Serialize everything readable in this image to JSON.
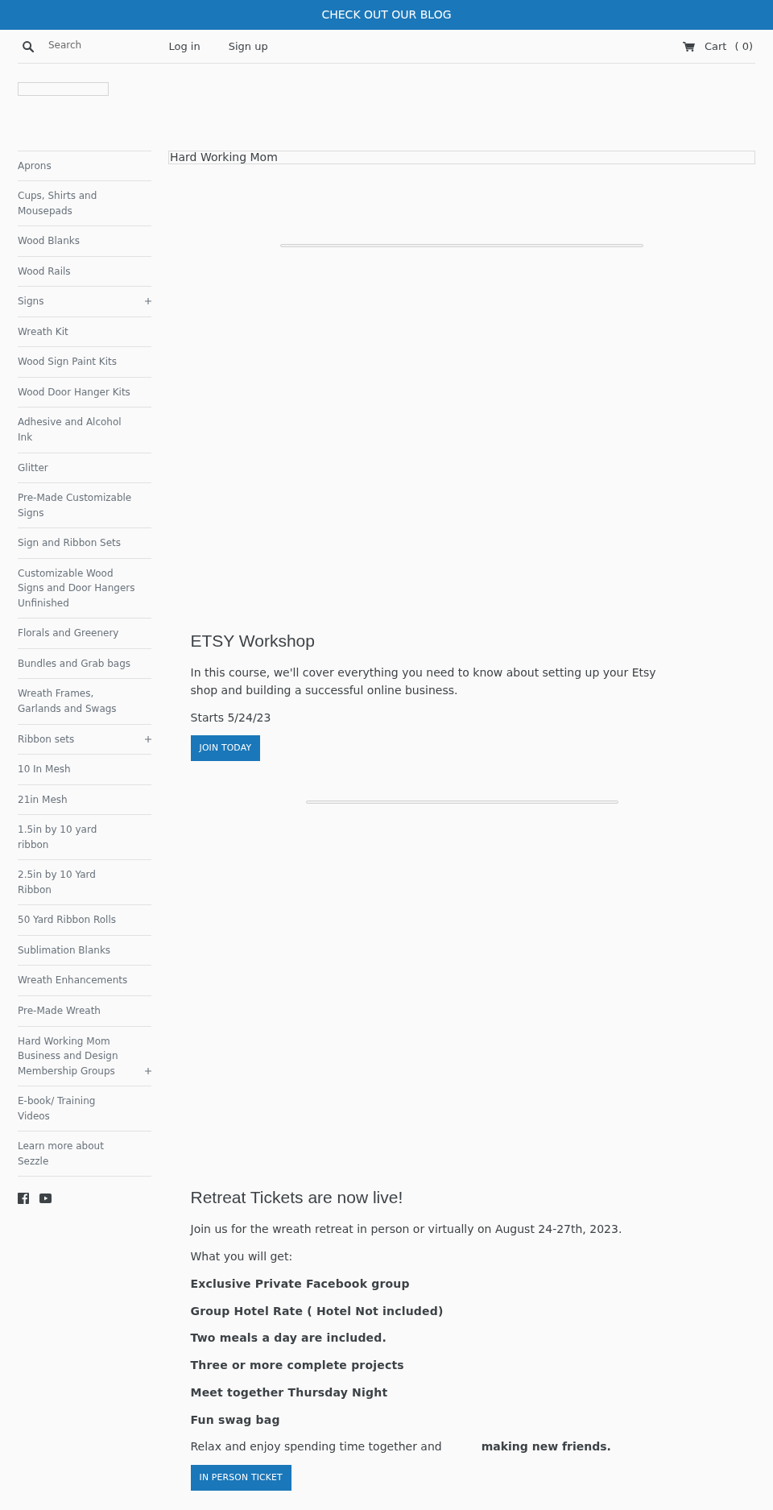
{
  "announcement": {
    "text": "CHECK OUT OUR BLOG"
  },
  "header": {
    "search": {
      "placeholder": "Search"
    },
    "links": [
      {
        "label": "Log in"
      },
      {
        "label": "Sign up"
      }
    ],
    "cart": {
      "label": "Cart",
      "count": "( 0)"
    }
  },
  "sidebar": {
    "items": [
      {
        "label": "Aprons",
        "expandable": false
      },
      {
        "label": "Cups, Shirts and\nMousepads",
        "expandable": false
      },
      {
        "label": "Wood Blanks",
        "expandable": false
      },
      {
        "label": "Wood Rails",
        "expandable": false
      },
      {
        "label": "Signs",
        "expandable": true
      },
      {
        "label": "Wreath Kit",
        "expandable": false
      },
      {
        "label": "Wood Sign Paint Kits",
        "expandable": false
      },
      {
        "label": "Wood Door Hanger Kits",
        "expandable": false
      },
      {
        "label": "Adhesive and Alcohol\nInk",
        "expandable": false
      },
      {
        "label": "Glitter",
        "expandable": false
      },
      {
        "label": "Pre-Made Customizable\nSigns",
        "expandable": false
      },
      {
        "label": "Sign and Ribbon Sets",
        "expandable": false
      },
      {
        "label": "Customizable Wood\nSigns and Door Hangers\nUnfinished",
        "expandable": false
      },
      {
        "label": "Florals and Greenery",
        "expandable": false
      },
      {
        "label": "Bundles and Grab bags",
        "expandable": false
      },
      {
        "label": "Wreath Frames,\nGarlands and Swags",
        "expandable": false
      },
      {
        "label": "Ribbon sets",
        "expandable": true
      },
      {
        "label": "10 In Mesh",
        "expandable": false
      },
      {
        "label": "21in Mesh",
        "expandable": false
      },
      {
        "label": "1.5in by 10 yard\nribbon",
        "expandable": false
      },
      {
        "label": "2.5in by 10 Yard\nRibbon",
        "expandable": false
      },
      {
        "label": "50 Yard Ribbon Rolls",
        "expandable": false
      },
      {
        "label": "Sublimation Blanks",
        "expandable": false
      },
      {
        "label": "Wreath Enhancements",
        "expandable": false
      },
      {
        "label": "Pre-Made Wreath",
        "expandable": false
      },
      {
        "label": "Hard Working Mom\nBusiness and Design\nMembership Groups",
        "expandable": true
      },
      {
        "label": "E-book/ Training\nVideos",
        "expandable": false
      },
      {
        "label": "Learn more about\nSezzle",
        "expandable": false
      }
    ],
    "social": [
      {
        "kind": "facebook"
      },
      {
        "kind": "youtube"
      }
    ]
  },
  "featured_image": {
    "alt_text": "Hard Working Mom"
  },
  "sections": [
    {
      "heading": "ETSY Workshop",
      "paragraphs": [
        {
          "text": "In this course, we'll cover everything you need to know about setting up your Etsy shop and building a successful online business.",
          "bold": false
        },
        {
          "text": "Starts 5/24/23",
          "bold": false
        }
      ],
      "button": "JOIN TODAY"
    },
    {
      "heading": "Retreat Tickets are now live!",
      "paragraphs": [
        {
          "text": "Join us for the wreath retreat in person or virtually on August 24-27th, 2023.",
          "bold": false
        },
        {
          "text": "What you will get:",
          "bold": false
        },
        {
          "text": "Exclusive Private Facebook group",
          "bold": true
        },
        {
          "text": "Group Hotel Rate ( Hotel Not included)",
          "bold": true
        },
        {
          "text": "Two meals a day are included.",
          "bold": true
        },
        {
          "text": "Three or more complete projects",
          "bold": true
        },
        {
          "text": "Meet together Thursday Night",
          "bold": true
        },
        {
          "text": "Fun swag bag",
          "bold": true
        },
        {
          "text": "Relax and enjoy spending time together and           **making new friends.**",
          "bold": false
        }
      ],
      "button": "IN PERSON TICKET"
    }
  ]
}
